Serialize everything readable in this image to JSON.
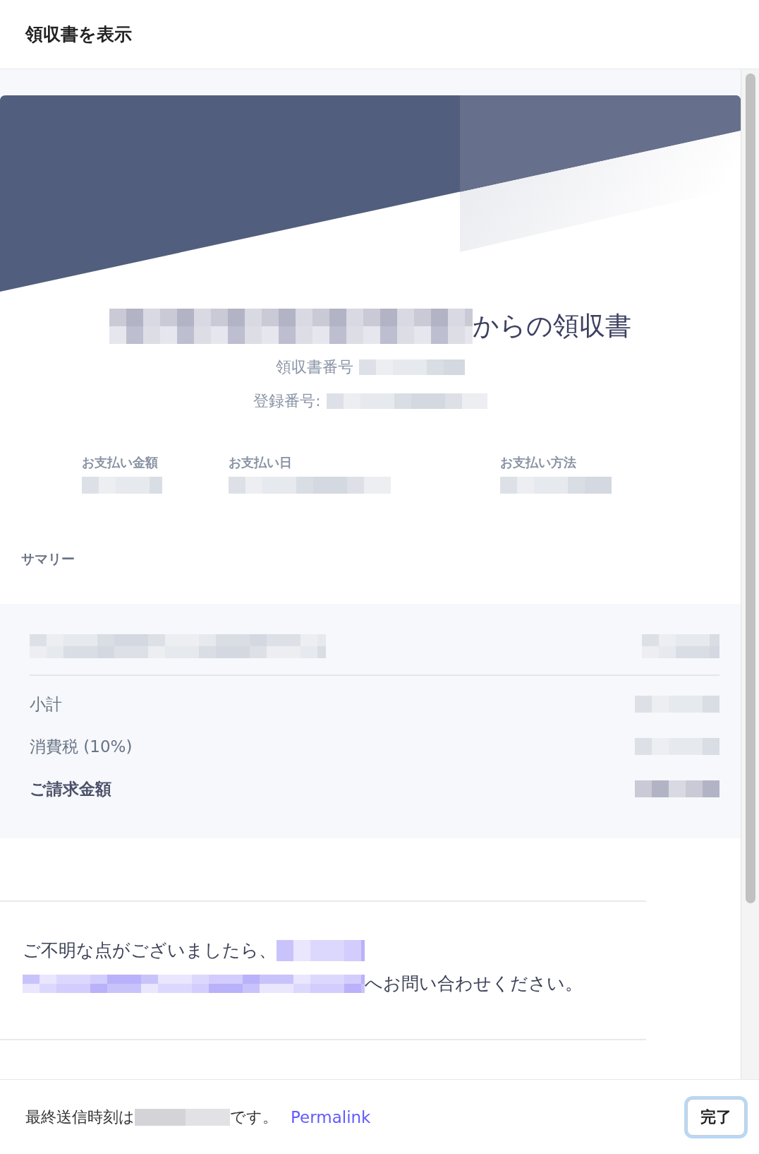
{
  "dialog": {
    "title": "領収書を表示"
  },
  "receipt": {
    "title_suffix": "からの領収書",
    "receipt_number_label": "領収書番号",
    "registration_label": "登録番号:",
    "payment_fields": [
      {
        "label": "お支払い金額"
      },
      {
        "label": "お支払い日"
      },
      {
        "label": "お支払い方法"
      }
    ],
    "summary_heading": "サマリー",
    "totals": [
      {
        "label": "小計",
        "kind": "normal"
      },
      {
        "label": "消費税 (10%)",
        "kind": "normal"
      },
      {
        "label": "ご請求金額",
        "kind": "total"
      }
    ]
  },
  "contact": {
    "before": "ご不明な点がございましたら、",
    "after": "へお問い合わせください。"
  },
  "footer": {
    "before": "最終送信時刻は",
    "after": "です。",
    "link": "Permalink",
    "button": "完了"
  }
}
